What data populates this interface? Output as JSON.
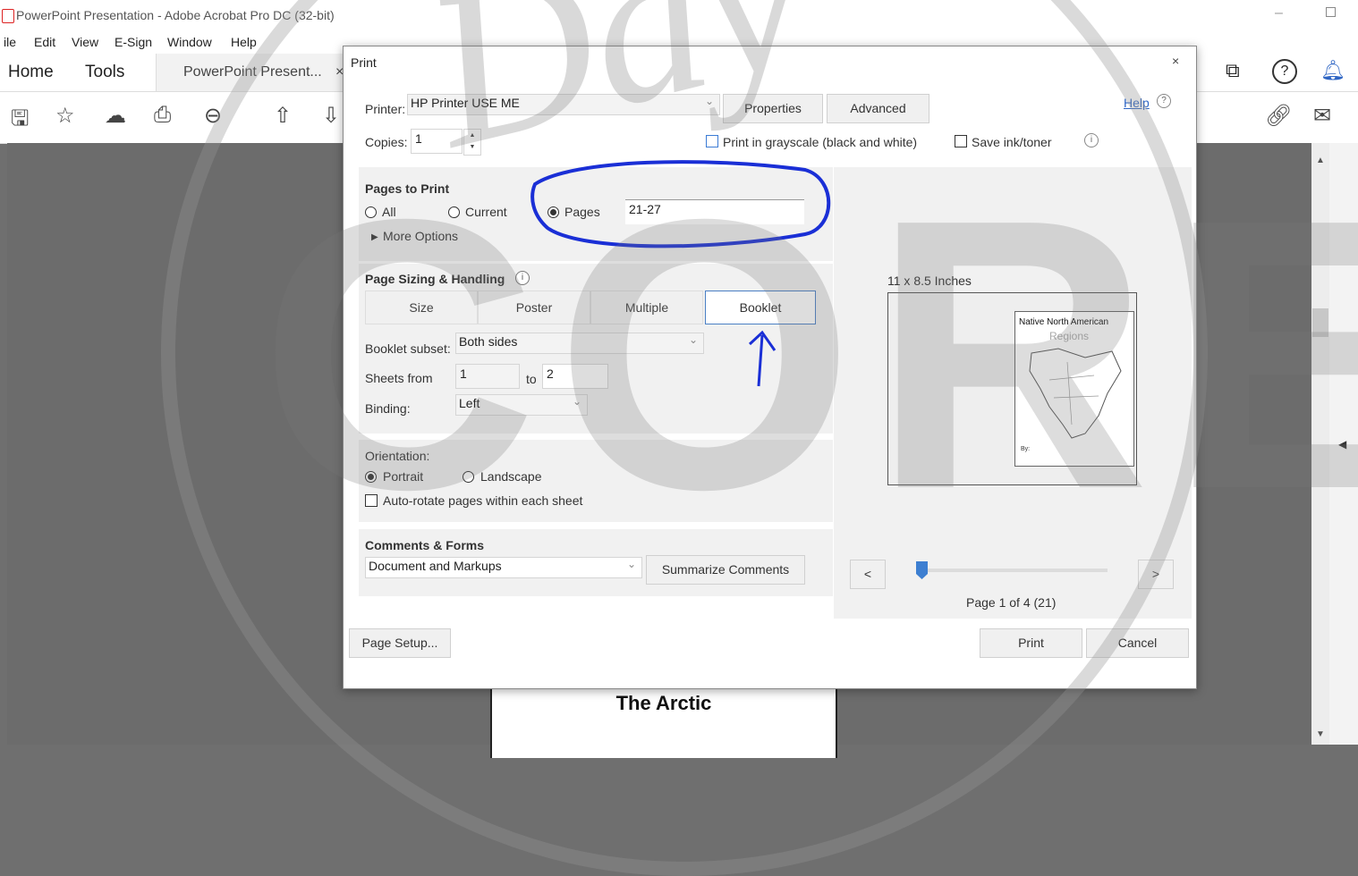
{
  "app": {
    "window_title": "PowerPoint Presentation - Adobe Acrobat Pro DC (32-bit)",
    "menu": [
      "ile",
      "Edit",
      "View",
      "E-Sign",
      "Window",
      "Help"
    ],
    "tabs": {
      "home": "Home",
      "tools": "Tools",
      "document": "PowerPoint Present..."
    },
    "tab_close": "×",
    "toolbar_icons": [
      "save-icon",
      "star-icon",
      "upload-cloud-icon",
      "print-icon",
      "zoom-out-icon",
      "page-up-icon",
      "page-down-icon"
    ],
    "right_icons": [
      "share-screen-icon",
      "help-icon",
      "notification-bell-icon",
      "link-share-icon",
      "mail-icon"
    ]
  },
  "background_page": {
    "title": "The Arctic"
  },
  "watermark": {
    "text_top": "Day",
    "text_main": "CORE"
  },
  "dialog": {
    "title": "Print",
    "close": "×",
    "printer_label": "Printer:",
    "printer_value": "HP Printer USE ME",
    "properties_button": "Properties",
    "advanced_button": "Advanced",
    "help_link": "Help",
    "copies_label": "Copies:",
    "copies_value": "1",
    "grayscale_label": "Print in grayscale (black and white)",
    "save_ink_label": "Save ink/toner",
    "pages_to_print": {
      "heading": "Pages to Print",
      "all": "All",
      "current": "Current",
      "pages": "Pages",
      "pages_value": "21-27",
      "more_options": "More Options",
      "selected": "pages"
    },
    "sizing": {
      "heading": "Page Sizing & Handling",
      "tabs": [
        "Size",
        "Poster",
        "Multiple",
        "Booklet"
      ],
      "active_tab": "Booklet",
      "booklet_subset_label": "Booklet subset:",
      "booklet_subset_value": "Both sides",
      "sheets_from_label": "Sheets from",
      "sheets_from_value": "1",
      "sheets_to_label": "to",
      "sheets_to_value": "2",
      "binding_label": "Binding:",
      "binding_value": "Left"
    },
    "orientation": {
      "heading": "Orientation:",
      "portrait": "Portrait",
      "landscape": "Landscape",
      "selected": "portrait",
      "auto_rotate": "Auto-rotate pages within each sheet"
    },
    "comments": {
      "heading": "Comments & Forms",
      "value": "Document and Markups",
      "summarize_button": "Summarize Comments"
    },
    "preview": {
      "size_label": "11 x 8.5 Inches",
      "page_heading": "Native North American",
      "page_subheading": "Regions",
      "page_by": "By:",
      "prev_button": "<",
      "next_button": ">",
      "page_status": "Page 1 of 4 (21)",
      "slider_fraction": 0.0
    },
    "page_setup_button": "Page Setup...",
    "print_button": "Print",
    "cancel_button": "Cancel"
  },
  "colors": {
    "accent": "#2e65c4",
    "annotation": "#1a2fd6",
    "workspace": "#6c6c6c"
  }
}
